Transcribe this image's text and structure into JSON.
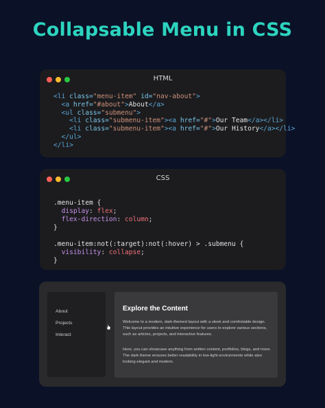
{
  "title": "Collapsable Menu in CSS",
  "html_card": {
    "title": "HTML",
    "lines": [
      [
        "<li ",
        "class=",
        "\"menu-item\"",
        " id=",
        "\"nav-about\"",
        ">"
      ],
      [
        "  <a ",
        "href=",
        "\"#about\"",
        ">",
        "About",
        "</a>"
      ],
      [
        "  <ul ",
        "class=",
        "\"submenu\"",
        ">"
      ],
      [
        "    <li ",
        "class=",
        "\"submenu-item\"",
        "><a ",
        "href=",
        "\"#\"",
        ">",
        "Our Team",
        "</a></li>"
      ],
      [
        "    <li ",
        "class=",
        "\"submenu-item\"",
        "><a ",
        "href=",
        "\"#\"",
        ">",
        "Our History",
        "</a></li>"
      ],
      [
        "  </ul>"
      ],
      [
        "</li>"
      ]
    ]
  },
  "css_card": {
    "title": "CSS",
    "rule1_selector": ".menu-item {",
    "rule1_decls": [
      {
        "prop": "display",
        "value": "flex"
      },
      {
        "prop": "flex-direction",
        "value": "column"
      }
    ],
    "rule1_close": "}",
    "rule2_selector": ".menu-item:not(:target):not(:hover) > .submenu {",
    "rule2_decls": [
      {
        "prop": "visibility",
        "value": "collapse"
      }
    ],
    "rule2_close": "}"
  },
  "demo": {
    "menu": [
      "About",
      "Projects",
      "Interact"
    ],
    "heading": "Explore the Content",
    "paragraph1": "Welcome to a modern, dark-themed layout with a sleek and comfortable design. This layout provides an intuitive experience for users to explore various sections, such as articles, projects, and interactive features.",
    "paragraph2": "Here, you can showcase anything from written content, portfolios, blogs, and more. The dark theme ensures better readability in low-light environments while also looking elegant and modern."
  },
  "colors": {
    "title": "#2dd4bf",
    "background": "#0b1127",
    "dot_red": "#ff5f57",
    "dot_yellow": "#febc2e",
    "dot_green": "#28c840"
  }
}
